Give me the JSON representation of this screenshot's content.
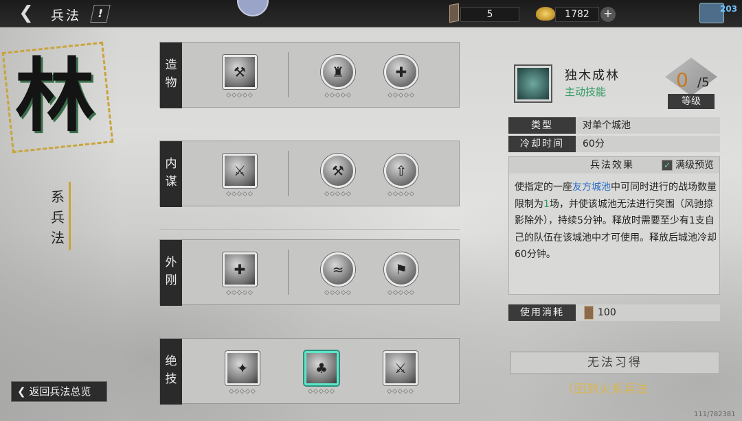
{
  "header": {
    "back_icon": "chevron-left",
    "title": "兵法",
    "help_label": "!",
    "token_count": "5",
    "gold_count": "1782",
    "plus_label": "+",
    "mail_count": "203"
  },
  "school": {
    "char": "林",
    "label": "系兵法",
    "return_label": "返回兵法总览"
  },
  "rows": [
    {
      "category": "造物",
      "skills": [
        {
          "glyph": "⚒"
        },
        {
          "glyph": "♜"
        },
        {
          "glyph": "✚"
        }
      ]
    },
    {
      "category": "内谋",
      "skills": [
        {
          "glyph": "⚔"
        },
        {
          "glyph": "⚒"
        },
        {
          "glyph": "⇧"
        }
      ]
    },
    {
      "category": "外刚",
      "skills": [
        {
          "glyph": "✚"
        },
        {
          "glyph": "≈"
        },
        {
          "glyph": "⚑"
        }
      ]
    },
    {
      "category": "绝技",
      "skills": [
        {
          "glyph": "✦"
        },
        {
          "glyph": "♣",
          "selected": true
        },
        {
          "glyph": "⚔"
        }
      ]
    }
  ],
  "stars": "◇◇◇◇◇",
  "detail": {
    "name": "独木成林",
    "kind": "主动技能",
    "level": "0",
    "level_max": "/5",
    "level_label": "等级",
    "type_key": "类型",
    "type_val": "对单个城池",
    "cooldown_key": "冷却时间",
    "cooldown_val": "60分",
    "effect_title": "兵法效果",
    "max_preview_label": "满级预览",
    "effect_part1": "使指定的一座",
    "effect_link": "友方城池",
    "effect_part2": "中可同时进行的战场数量限制为",
    "effect_num": "1",
    "effect_part3": "场，并使该城池无法进行突围（风驰掠影除外），持续5分钟。释放时需要至少有1支自己的队伍在该城池中才可使用。释放后城池冷却60分钟。",
    "cost_key": "使用消耗",
    "cost_val": "100",
    "learn_label": "无法习得",
    "back_fire_label": "〈回到火系兵法"
  },
  "footer_id": "111/782381",
  "colors": {
    "accent_green": "#2c9a63",
    "link_blue": "#2d6ec9",
    "level_orange": "#c67a22",
    "gold": "#d9b650",
    "selected_border": "#5ee6c9"
  }
}
